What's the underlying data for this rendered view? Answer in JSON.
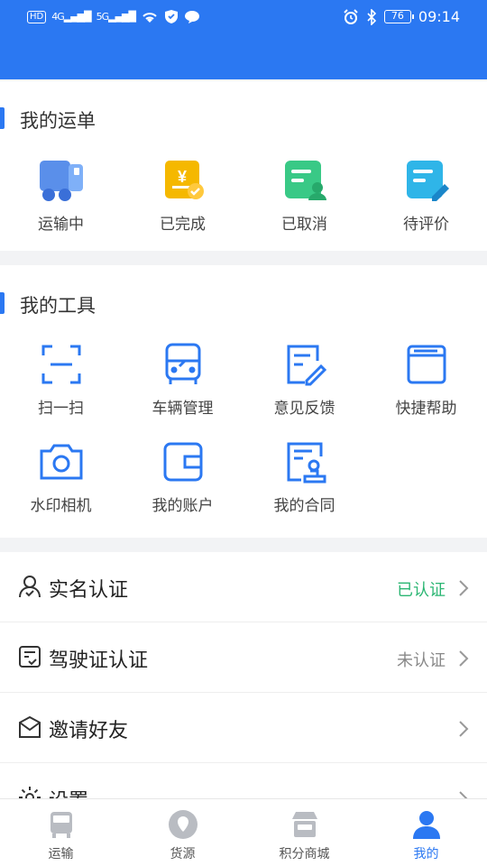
{
  "status_bar": {
    "left_icons": [
      "hd-icon",
      "signal-4g-icon",
      "signal-5g-icon",
      "wifi-icon",
      "shield-icon",
      "message-icon"
    ],
    "hd_label": "HD",
    "sig1_label": "4G",
    "sig2_label": "5G",
    "battery": "76",
    "time": "09:14"
  },
  "orders": {
    "title": "我的运单",
    "items": [
      {
        "label": "运输中",
        "icon": "truck-icon"
      },
      {
        "label": "已完成",
        "icon": "yuan-check-icon"
      },
      {
        "label": "已取消",
        "icon": "doc-user-icon"
      },
      {
        "label": "待评价",
        "icon": "doc-edit-icon"
      }
    ]
  },
  "tools": {
    "title": "我的工具",
    "items": [
      {
        "label": "扫一扫",
        "icon": "scan-icon"
      },
      {
        "label": "车辆管理",
        "icon": "bus-icon"
      },
      {
        "label": "意见反馈",
        "icon": "feedback-icon"
      },
      {
        "label": "快捷帮助",
        "icon": "help-window-icon"
      },
      {
        "label": "水印相机",
        "icon": "camera-icon"
      },
      {
        "label": "我的账户",
        "icon": "wallet-icon"
      },
      {
        "label": "我的合同",
        "icon": "contract-stamp-icon"
      }
    ]
  },
  "menu": {
    "rows": [
      {
        "label": "实名认证",
        "status": "已认证",
        "icon": "user-verify-icon"
      },
      {
        "label": "驾驶证认证",
        "status": "未认证",
        "icon": "license-icon"
      },
      {
        "label": "邀请好友",
        "status": "",
        "icon": "envelope-icon"
      },
      {
        "label": "设置",
        "status": "",
        "icon": "gear-icon"
      }
    ]
  },
  "tabbar": {
    "tabs": [
      {
        "label": "运输",
        "icon": "bus-tab-icon",
        "active": false
      },
      {
        "label": "货源",
        "icon": "location-tab-icon",
        "active": false
      },
      {
        "label": "积分商城",
        "icon": "store-tab-icon",
        "active": false
      },
      {
        "label": "我的",
        "icon": "user-tab-icon",
        "active": true
      }
    ]
  },
  "colors": {
    "primary": "#2b78f2",
    "verified": "#2bb673",
    "orange": "#f5b800",
    "green": "#39c986",
    "teal": "#2fb5e8"
  }
}
